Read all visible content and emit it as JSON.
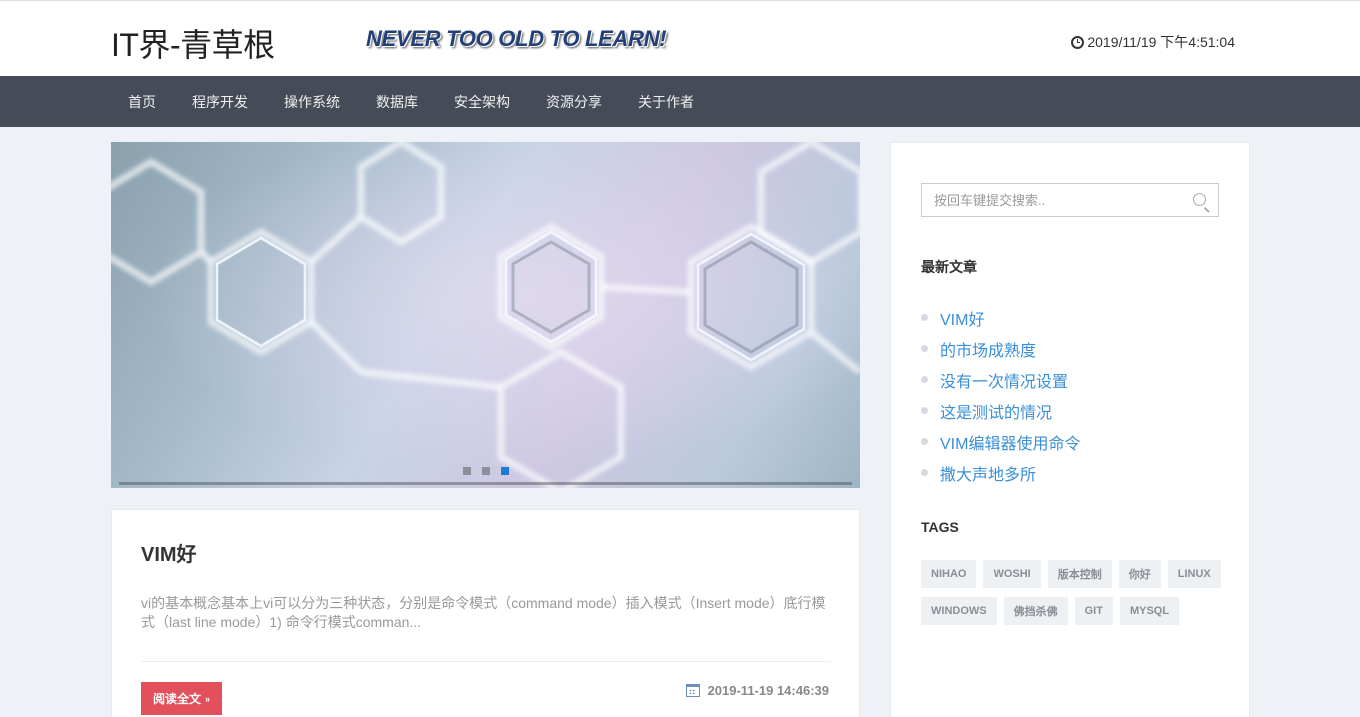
{
  "header": {
    "site_title": "IT界-青草根",
    "slogan": "NEVER TOO OLD TO LEARN!",
    "datetime": "2019/11/19 下午4:51:04"
  },
  "nav": {
    "items": [
      "首页",
      "程序开发",
      "操作系统",
      "数据库",
      "安全架构",
      "资源分享",
      "关于作者"
    ]
  },
  "slider": {
    "slides": 3,
    "active_index": 2
  },
  "post": {
    "title": "VIM好",
    "excerpt": "vi的基本概念基本上vi可以分为三种状态，分别是命令模式（command mode）插入模式（Insert mode）底行模式（last line mode）1) 命令行模式comman...",
    "read_more": "阅读全文",
    "date": "2019-11-19 14:46:39"
  },
  "sidebar": {
    "search_placeholder": "按回车键提交搜索..",
    "recent_title": "最新文章",
    "recent_posts": [
      "VIM好",
      "的市场成熟度",
      "没有一次情况设置",
      "这是测试的情况",
      "VIM编辑器使用命令",
      "撒大声地多所"
    ],
    "tags_title": "TAGS",
    "tags": [
      "NIHAO",
      "WOSHI",
      "版本控制",
      "你好",
      "LINUX",
      "WINDOWS",
      "佛挡杀佛",
      "GIT",
      "MYSQL"
    ]
  },
  "colors": {
    "nav_bg": "#464c57",
    "link": "#3a8fd8",
    "button": "#e2505c",
    "active_dot": "#1e7ad8"
  }
}
